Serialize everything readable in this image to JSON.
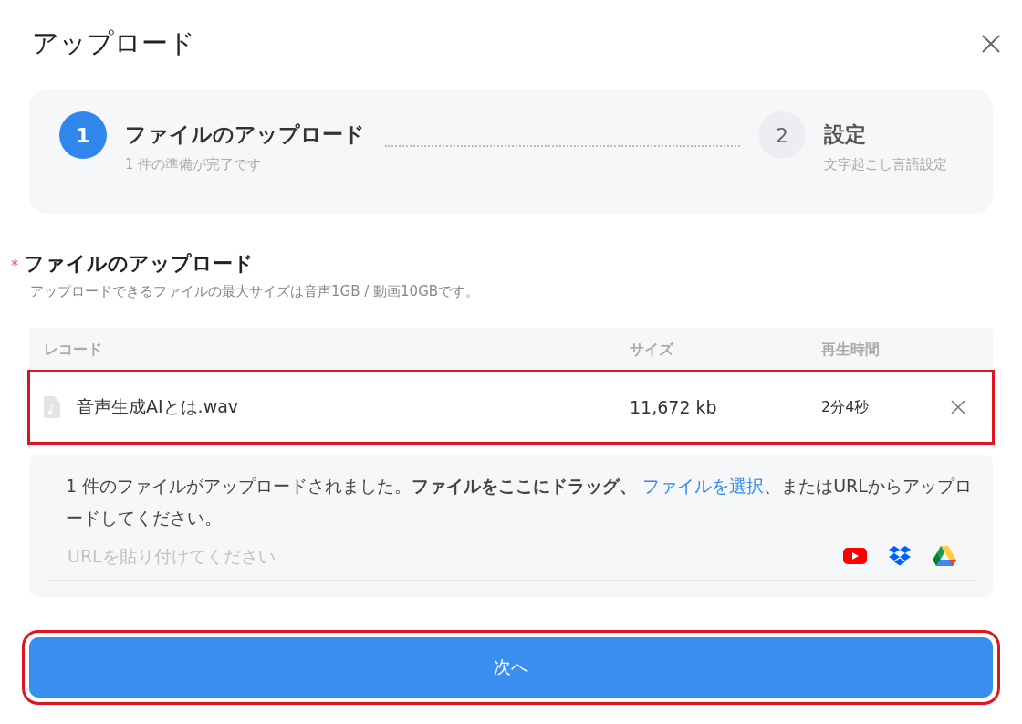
{
  "dialog": {
    "title": "アップロード"
  },
  "steps": [
    {
      "number": "1",
      "title": "ファイルのアップロード",
      "subtitle": "1 件の準備が完了です",
      "selected": true
    },
    {
      "number": "2",
      "title": "設定",
      "subtitle": "文字起こし言語設定",
      "selected": false
    }
  ],
  "section": {
    "required_mark": "*",
    "title": "ファイルのアップロード",
    "hint": "アップロードできるファイルの最大サイズは音声1GB / 動画10GBです。"
  },
  "table": {
    "columns": [
      "レコード",
      "サイズ",
      "再生時間"
    ],
    "rows": [
      {
        "name": "音声生成AIとは.wav",
        "size": "11,672 kb",
        "duration": "2分4秒",
        "highlighted": true
      }
    ]
  },
  "drop_area": {
    "text_before": "1 件のファイルがアップロードされました。**ファイルをここにドラッグ、**",
    "link": "ファイルを選択",
    "text_after": "、またはURLからアップロードしてください。",
    "url_placeholder": "URLを貼り付けてください"
  },
  "next_button": {
    "label": "次へ",
    "highlighted": true
  }
}
